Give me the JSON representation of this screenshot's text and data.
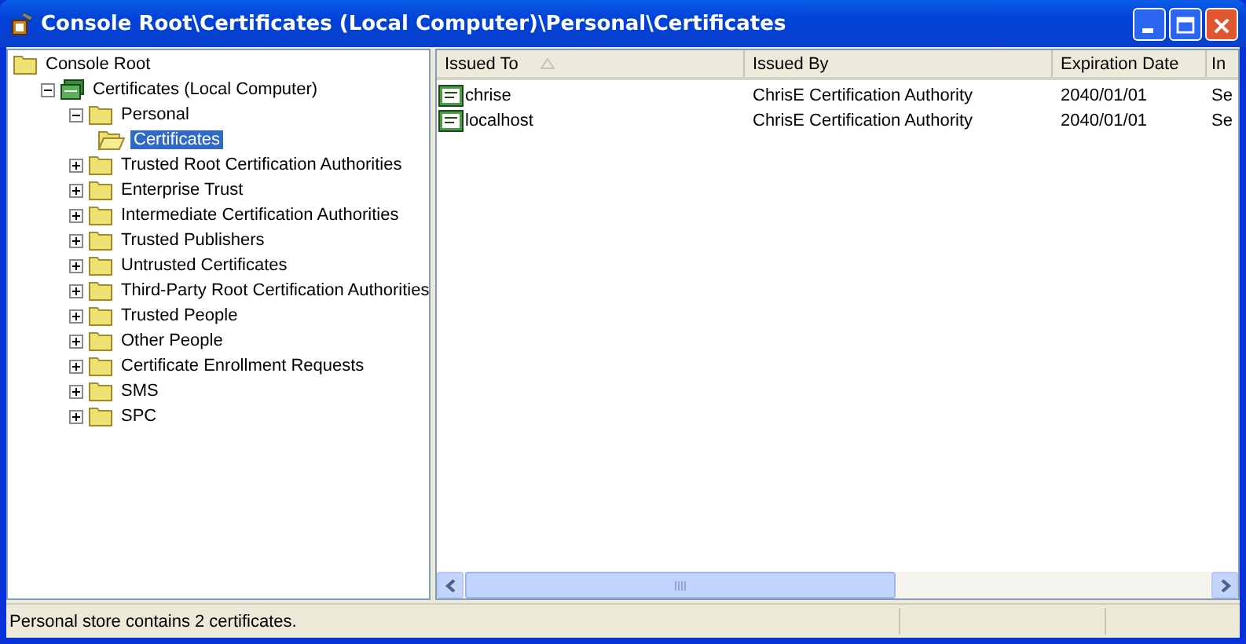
{
  "window": {
    "title": "Console Root\\Certificates (Local Computer)\\Personal\\Certificates"
  },
  "tree": [
    {
      "label": "Console Root",
      "kind": "folder",
      "selected": false,
      "children": [
        {
          "label": "Certificates (Local Computer)",
          "kind": "snapin",
          "selected": false,
          "expanded": true,
          "children": [
            {
              "label": "Personal",
              "kind": "folder",
              "selected": false,
              "expanded": true,
              "children": [
                {
                  "label": "Certificates",
                  "kind": "open-folder",
                  "selected": true
                }
              ]
            },
            {
              "label": "Trusted Root Certification Authorities",
              "kind": "folder",
              "selected": false,
              "expanded": false
            },
            {
              "label": "Enterprise Trust",
              "kind": "folder",
              "selected": false,
              "expanded": false
            },
            {
              "label": "Intermediate Certification Authorities",
              "kind": "folder",
              "selected": false,
              "expanded": false
            },
            {
              "label": "Trusted Publishers",
              "kind": "folder",
              "selected": false,
              "expanded": false
            },
            {
              "label": "Untrusted Certificates",
              "kind": "folder",
              "selected": false,
              "expanded": false
            },
            {
              "label": "Third-Party Root Certification Authorities",
              "kind": "folder",
              "selected": false,
              "expanded": false
            },
            {
              "label": "Trusted People",
              "kind": "folder",
              "selected": false,
              "expanded": false
            },
            {
              "label": "Other People",
              "kind": "folder",
              "selected": false,
              "expanded": false
            },
            {
              "label": "Certificate Enrollment Requests",
              "kind": "folder",
              "selected": false,
              "expanded": false
            },
            {
              "label": "SMS",
              "kind": "folder",
              "selected": false,
              "expanded": false
            },
            {
              "label": "SPC",
              "kind": "folder",
              "selected": false,
              "expanded": false
            }
          ]
        }
      ]
    }
  ],
  "table": {
    "columns": [
      {
        "label": "Issued To",
        "sorted": true
      },
      {
        "label": "Issued By",
        "sorted": false
      },
      {
        "label": "Expiration Date",
        "sorted": false
      },
      {
        "label": "In",
        "sorted": false
      }
    ],
    "rows": [
      [
        "chrise",
        "ChrisE Certification Authority",
        "2040/01/01",
        "Se"
      ],
      [
        "localhost",
        "ChrisE Certification Authority",
        "2040/01/01",
        "Se"
      ]
    ]
  },
  "status_bar": "Personal store contains 2 certificates."
}
